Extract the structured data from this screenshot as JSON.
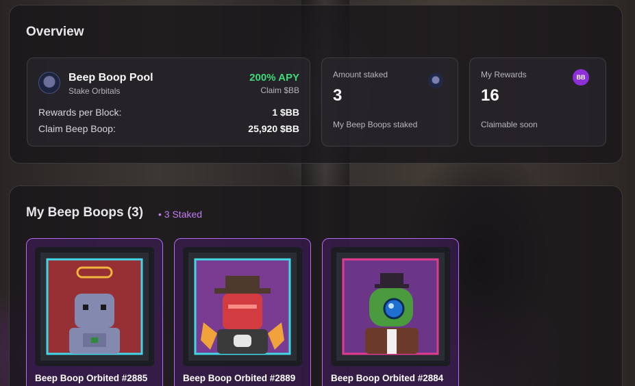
{
  "overview": {
    "title": "Overview",
    "pool": {
      "name": "Beep Boop Pool",
      "subtitle": "Stake Orbitals",
      "apy": "200% APY",
      "claim_label": "Claim $BB",
      "rows": [
        {
          "label": "Rewards per Block:",
          "value": "1 $BB"
        },
        {
          "label": "Claim Beep Boop:",
          "value": "25,920 $BB"
        }
      ]
    },
    "staked": {
      "label": "Amount staked",
      "value": "3",
      "footer": "My Beep Boops staked"
    },
    "rewards": {
      "label": "My Rewards",
      "badge": "BB",
      "value": "16",
      "footer": "Claimable soon"
    }
  },
  "collection": {
    "title": "My Beep Boops (3)",
    "staked_badge": "• 3 Staked",
    "items": [
      {
        "name": "Beep Boop Orbited #2885"
      },
      {
        "name": "Beep Boop Orbited #2889"
      },
      {
        "name": "Beep Boop Orbited #2884"
      }
    ]
  },
  "colors": {
    "apy_green": "#3fd97a",
    "accent_purple": "#b46cf0",
    "badge_purple": "#8e2fd8"
  }
}
